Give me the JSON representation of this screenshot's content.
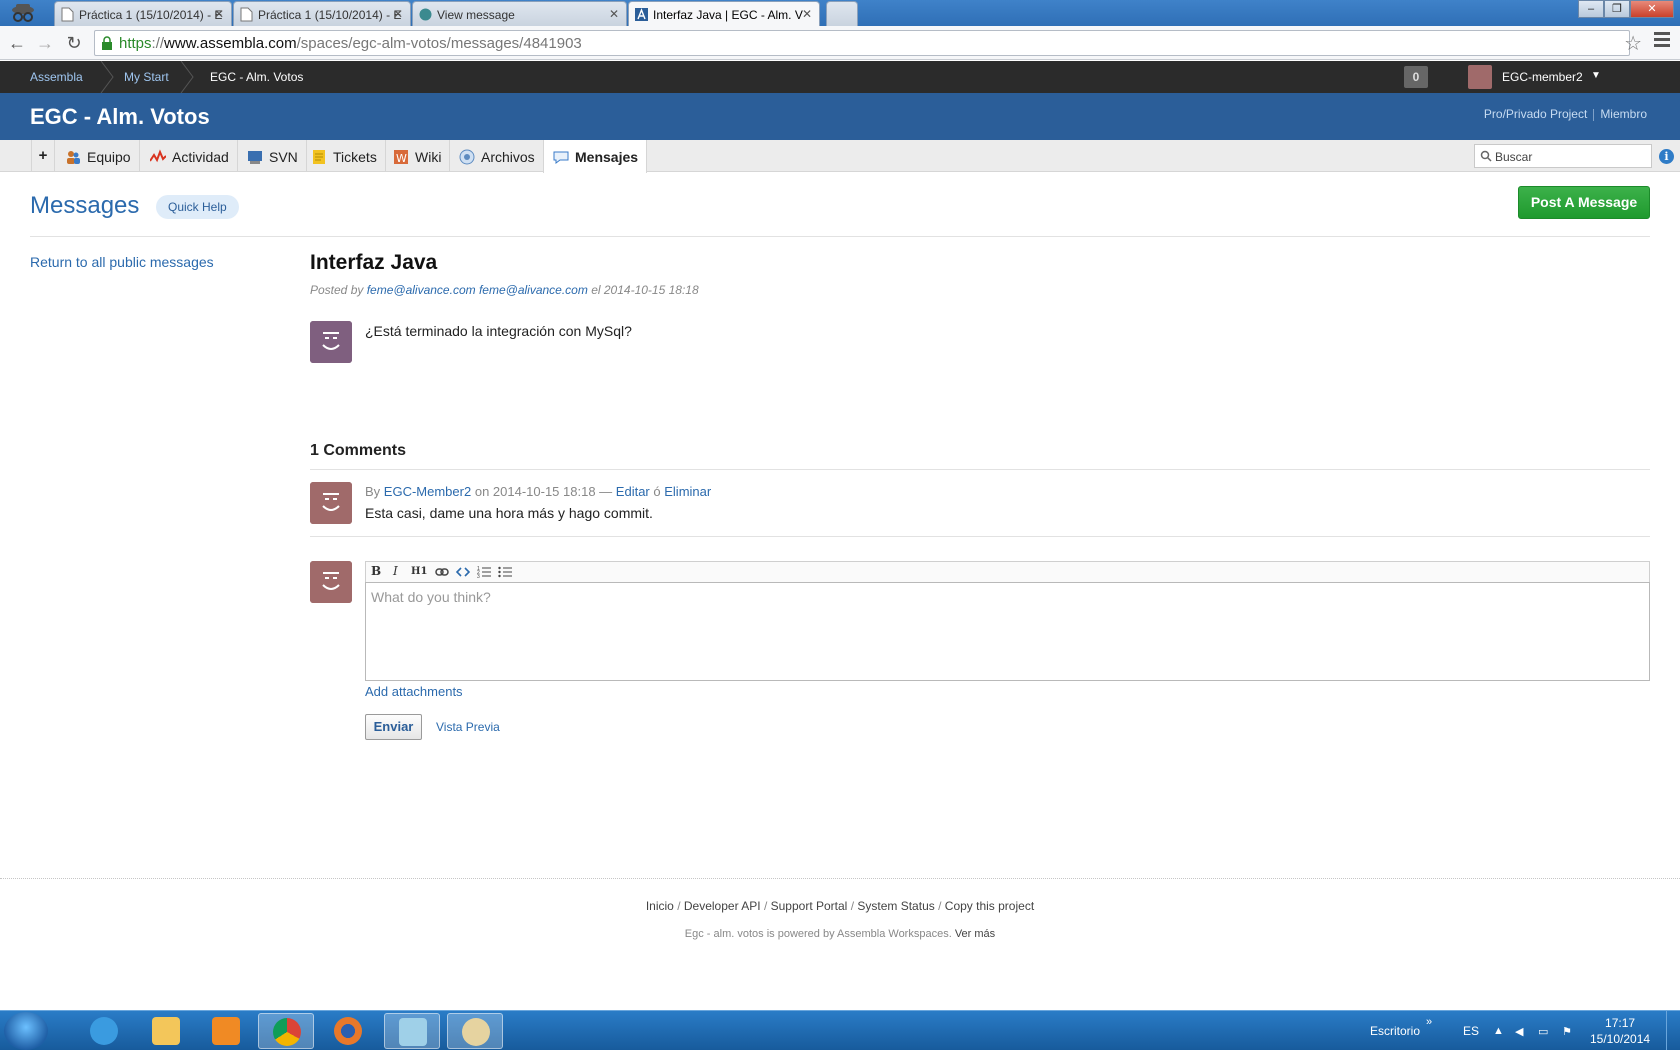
{
  "browser": {
    "tabs": [
      {
        "label": "Práctica 1 (15/10/2014) - E",
        "icon": "doc-icon"
      },
      {
        "label": "Práctica 1 (15/10/2014) - E",
        "icon": "doc-icon"
      },
      {
        "label": "View message",
        "icon": "globe-icon"
      },
      {
        "label": "Interfaz Java | EGC - Alm. V",
        "icon": "assembla-icon"
      }
    ],
    "url_scheme": "https",
    "url_sep": "://",
    "url_host": "www.assembla.com",
    "url_path": "/spaces/egc-alm-votos/messages/4841903"
  },
  "topbar": {
    "breadcrumbs": [
      "Assembla",
      "My Start",
      "EGC - Alm. Votos"
    ],
    "notifications": "0",
    "user": "EGC-member2"
  },
  "project": {
    "title": "EGC - Alm. Votos",
    "links": [
      "Pro/Privado Project",
      "Miembro"
    ]
  },
  "tools": {
    "plus": "+",
    "items": [
      "Equipo",
      "Actividad",
      "SVN",
      "Tickets",
      "Wiki",
      "Archivos",
      "Mensajes"
    ],
    "active": "Mensajes",
    "search_placeholder": "Buscar"
  },
  "page": {
    "title": "Messages",
    "quick_help": "Quick Help",
    "post_button": "Post A Message",
    "return_link": "Return to all public messages"
  },
  "message": {
    "title": "Interfaz Java",
    "posted_by_label": "Posted by",
    "author_1": "feme@alivance.com",
    "author_2": "feme@alivance.com",
    "date_label": "el",
    "date": "2014-10-15 18:18",
    "body": "¿Está terminado la integración con MySql?"
  },
  "comments": {
    "heading": "1 Comments",
    "items": [
      {
        "by": "By",
        "author": "EGC-Member2",
        "on": "on 2014-10-15 18:18 —",
        "edit": "Editar",
        "or": "ó",
        "delete": "Eliminar",
        "text": "Esta casi, dame una hora más y hago commit."
      }
    ]
  },
  "editor": {
    "buttons": [
      "B",
      "I",
      "H1"
    ],
    "placeholder": "What do you think?",
    "add_attachments": "Add attachments",
    "send": "Enviar",
    "preview": "Vista Previa"
  },
  "footer": {
    "links": [
      "Inicio",
      "Developer API",
      "Support Portal",
      "System Status",
      "Copy this project"
    ],
    "powered": "Egc - alm. votos is powered by Assembla Workspaces.",
    "more": "Ver más"
  },
  "taskbar": {
    "desktop": "Escritorio",
    "lang": "ES",
    "time": "17:17",
    "date": "15/10/2014"
  },
  "colors": {
    "project_bar": "#2b5e99",
    "link": "#2b6aad",
    "post_button": "#2a9f38",
    "top_bar": "#2b2b2b"
  }
}
